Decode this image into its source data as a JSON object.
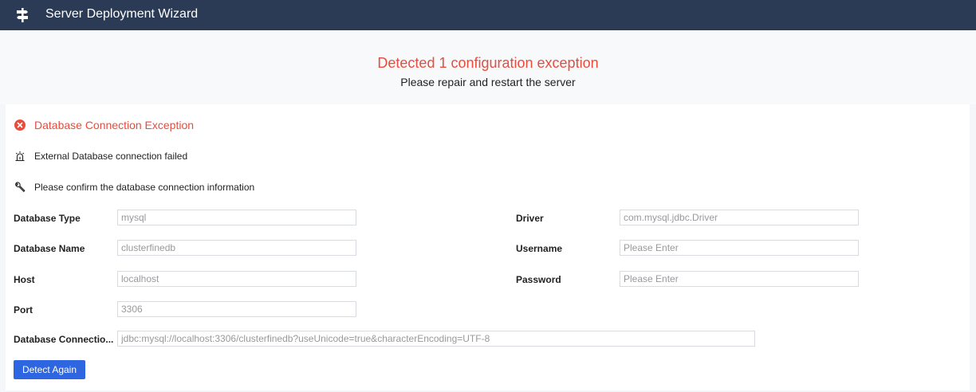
{
  "app": {
    "title": "Server Deployment Wizard",
    "icon": "signpost-icon"
  },
  "header": {
    "title": "Detected 1 configuration exception",
    "subtitle": "Please repair and restart the server"
  },
  "error": {
    "title": "Database Connection Exception",
    "title_icon": "error-circle-icon",
    "messages": [
      {
        "text": "External Database connection failed",
        "icon": "alarm-icon"
      },
      {
        "text": "Please confirm the database connection information",
        "icon": "wrench-icon"
      }
    ]
  },
  "form": {
    "database_type": {
      "label": "Database Type",
      "value": "mysql"
    },
    "database_name": {
      "label": "Database Name",
      "value": "clusterfinedb"
    },
    "host": {
      "label": "Host",
      "value": "localhost"
    },
    "port": {
      "label": "Port",
      "value": "3306"
    },
    "connection_url": {
      "label": "Database Connectio...",
      "value": "jdbc:mysql://localhost:3306/clusterfinedb?useUnicode=true&characterEncoding=UTF-8"
    },
    "driver": {
      "label": "Driver",
      "value": "com.mysql.jdbc.Driver"
    },
    "username": {
      "label": "Username",
      "value": "",
      "placeholder": "Please Enter"
    },
    "password": {
      "label": "Password",
      "value": "",
      "placeholder": "Please Enter"
    }
  },
  "actions": {
    "detect_again": "Detect Again"
  },
  "colors": {
    "topbar": "#2b3a55",
    "error": "#e74c3c",
    "primary": "#2d66e0"
  }
}
